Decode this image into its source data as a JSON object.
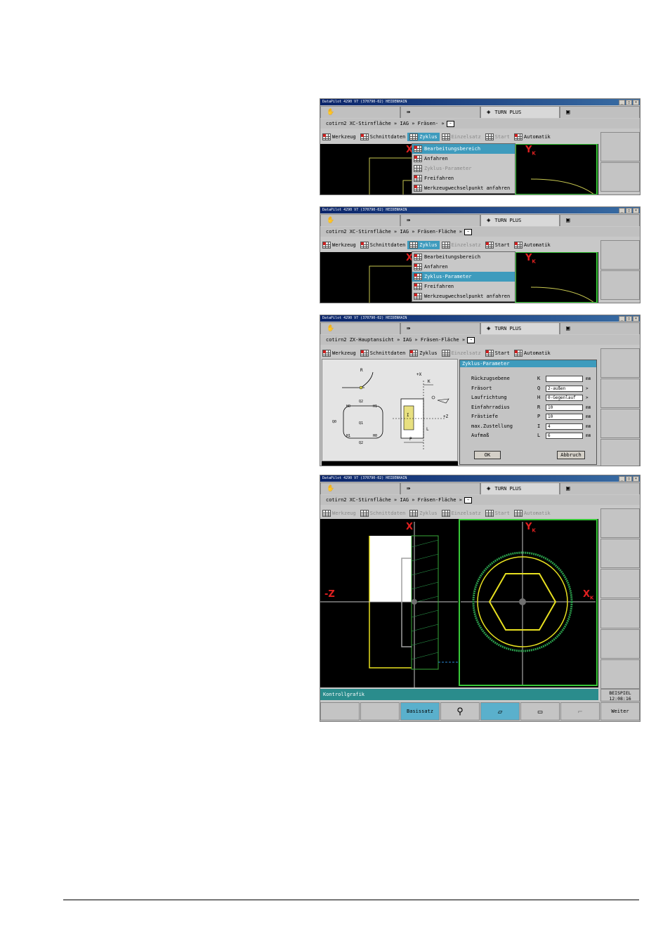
{
  "window": {
    "title": "DataPilot 4290 V7 (370790-02) HEIDENHAIN"
  },
  "tabs": {
    "tab3": "TURN PLUS"
  },
  "screens": [
    {
      "breadcrumb": "cotirn2  XC-Stirnfläche » IAG » Fräsen- »",
      "menu": [
        "Werkzeug",
        "Schnittdaten",
        "Zyklus",
        "Einzelsatz",
        "Start",
        "Automatik"
      ],
      "dropdown": [
        "Bearbeitungsbereich",
        "Anfahren",
        "Zyklus-Parameter",
        "Freifahren",
        "Werkzeugwechselpunkt anfahren"
      ]
    },
    {
      "breadcrumb": "cotirn2  XC-Stirnfläche » IAG » Fräsen-Fläche »",
      "menu": [
        "Werkzeug",
        "Schnittdaten",
        "Zyklus",
        "Einzelsatz",
        "Start",
        "Automatik"
      ],
      "dropdown": [
        "Bearbeitungsbereich",
        "Anfahren",
        "Zyklus-Parameter",
        "Freifahren",
        "Werkzeugwechselpunkt anfahren"
      ]
    },
    {
      "breadcrumb": "cotirn2  ZX-Hauptansicht » IAG » Fräsen-Fläche »",
      "menu": [
        "Werkzeug",
        "Schnittdaten",
        "Zyklus",
        "Einzelsatz",
        "Start",
        "Automatik"
      ],
      "dialog": {
        "title": "Zyklus-Parameter",
        "params": [
          {
            "label": "Rückzugsebene",
            "key": "K",
            "value": "",
            "unit": "mm"
          },
          {
            "label": "Fräsort",
            "key": "Q",
            "value": "2-außen",
            "unit": ">"
          },
          {
            "label": "Laufrichtung",
            "key": "H",
            "value": "0-Gegenlauf",
            "unit": ">"
          },
          {
            "label": "Einfahrradius",
            "key": "R",
            "value": "10",
            "unit": "mm"
          },
          {
            "label": "Frästiefe",
            "key": "P",
            "value": "10",
            "unit": "mm"
          },
          {
            "label": "max.Zustellung",
            "key": "I",
            "value": "4",
            "unit": "mm"
          },
          {
            "label": "Aufmaß",
            "key": "L",
            "value": "6",
            "unit": "mm"
          }
        ],
        "ok": "OK",
        "cancel": "Abbruch"
      },
      "diagram": {
        "r": "R",
        "q2": "Q2",
        "q1": "Q1",
        "q0": "Q0",
        "h0": "H0",
        "h1": "H1",
        "plus_x": "+X",
        "k": "K",
        "plus_z": "+Z",
        "p": "P",
        "i": "I",
        "l": "L"
      }
    },
    {
      "breadcrumb": "cotirn2  XC-Stirnfläche » IAG » Fräsen-Fläche »",
      "menu": [
        "Werkzeug",
        "Schnittdaten",
        "Zyklus",
        "Einzelsatz",
        "Start",
        "Automatik"
      ],
      "axes": {
        "x": "X",
        "minus_z": "-Z",
        "y": "Y",
        "y_sub": "K",
        "xk": "X",
        "xk_sub": "K"
      },
      "status": "Kontrollgrafik",
      "clock": {
        "name": "BEISPIEL",
        "time": "12:08:16"
      },
      "softkeys": {
        "basissatz": "Basissatz",
        "weiter": "Weiter"
      }
    }
  ]
}
